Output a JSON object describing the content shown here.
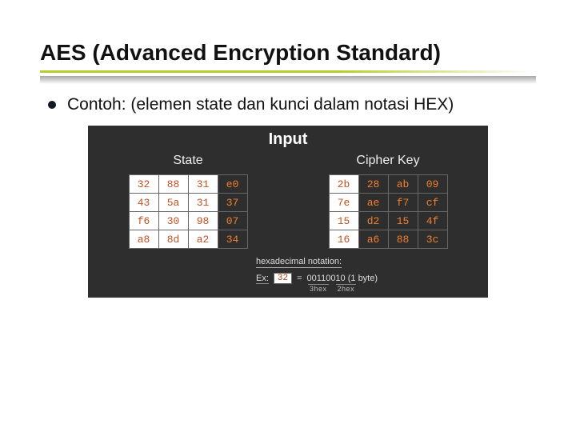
{
  "title": "AES (Advanced Encryption Standard)",
  "bullet": "Contoh: (elemen state dan kunci dalam notasi HEX)",
  "figure": {
    "input_label": "Input",
    "state_label": "State",
    "cipher_key_label": "Cipher Key",
    "state": {
      "r0": {
        "c0": "32",
        "c1": "88",
        "c2": "31",
        "c3": "e0"
      },
      "r1": {
        "c0": "43",
        "c1": "5a",
        "c2": "31",
        "c3": "37"
      },
      "r2": {
        "c0": "f6",
        "c1": "30",
        "c2": "98",
        "c3": "07"
      },
      "r3": {
        "c0": "a8",
        "c1": "8d",
        "c2": "a2",
        "c3": "34"
      }
    },
    "cipher_key": {
      "r0": {
        "c0": "2b",
        "c1": "28",
        "c2": "ab",
        "c3": "09"
      },
      "r1": {
        "c0": "7e",
        "c1": "ae",
        "c2": "f7",
        "c3": "cf"
      },
      "r2": {
        "c0": "15",
        "c1": "d2",
        "c2": "15",
        "c3": "4f"
      },
      "r3": {
        "c0": "16",
        "c1": "a6",
        "c2": "88",
        "c3": "3c"
      }
    },
    "notation_label": "hexadecimal notation:",
    "ex_label": "Ex:",
    "ex_value": "32",
    "ex_eq": "=",
    "ex_bin": "00110010 (1 byte)",
    "sub1": "3hex",
    "sub2": "2hex"
  }
}
